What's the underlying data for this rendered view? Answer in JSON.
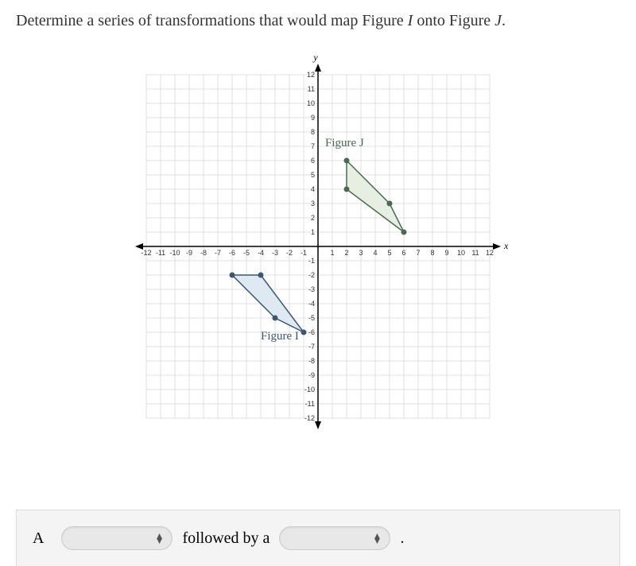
{
  "question": {
    "prefix": "Determine a series of transformations that would map Figure ",
    "figure_from": "I",
    "mid": " onto Figure ",
    "figure_to": "J",
    "suffix": "."
  },
  "answer": {
    "label": "A",
    "connector": "followed by a",
    "period": "."
  },
  "chart_data": {
    "type": "scatter",
    "xlim": [
      -12,
      12
    ],
    "ylim": [
      -12,
      12
    ],
    "xlabel": "x",
    "ylabel": "y",
    "grid": true,
    "x_ticks": [
      -12,
      -11,
      -10,
      -9,
      -8,
      -7,
      -6,
      -5,
      -4,
      -3,
      -2,
      -1,
      1,
      2,
      3,
      4,
      5,
      6,
      7,
      8,
      9,
      10,
      11,
      12
    ],
    "y_ticks": [
      -12,
      -11,
      -10,
      -9,
      -8,
      -7,
      -6,
      -5,
      -4,
      -3,
      -2,
      -1,
      1,
      2,
      3,
      4,
      5,
      6,
      7,
      8,
      9,
      10,
      11,
      12
    ],
    "series": [
      {
        "name": "Figure I",
        "label_pos": [
          -4,
          -6.5
        ],
        "fill": "#dfe9f2",
        "stroke": "#3b5773",
        "vertices": [
          [
            -6,
            -2
          ],
          [
            -4,
            -2
          ],
          [
            -1,
            -6
          ],
          [
            -3,
            -5
          ]
        ]
      },
      {
        "name": "Figure J",
        "label_pos": [
          0.5,
          7
        ],
        "fill": "#e7efe2",
        "stroke": "#4a6b4f",
        "vertices": [
          [
            2,
            6
          ],
          [
            2,
            4
          ],
          [
            6,
            1
          ],
          [
            5,
            3
          ]
        ]
      }
    ]
  }
}
